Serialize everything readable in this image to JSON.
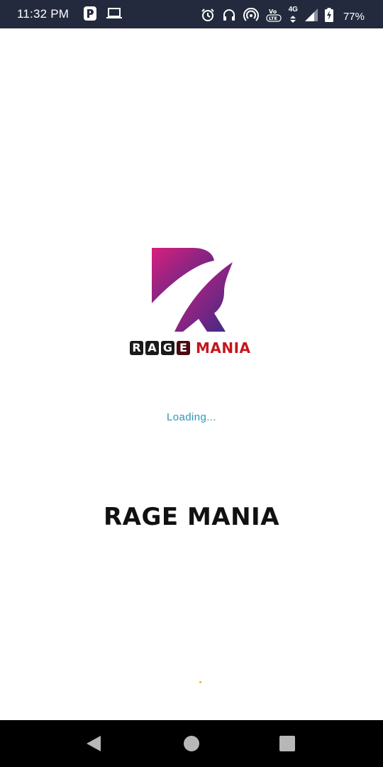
{
  "status_bar": {
    "time": "11:32 PM",
    "network_label": "4G",
    "volte_label": "Vo LTE",
    "battery_percent": "77%",
    "icons": [
      "p-app-icon",
      "laptop-icon",
      "alarm-icon",
      "headset-icon",
      "hotspot-icon",
      "volte-icon",
      "data-arrows-icon",
      "signal-icon",
      "battery-charging-icon"
    ]
  },
  "logo": {
    "letters": [
      "R",
      "A",
      "G",
      "E"
    ],
    "word": "MANIA",
    "colors": {
      "gradient_start": "#d81f7e",
      "gradient_end": "#3a2a86",
      "word": "#c4161c"
    }
  },
  "loading_text": "Loading...",
  "app_title": "RAGE MANIA",
  "navigation": {
    "icons": [
      "back-icon",
      "home-icon",
      "recents-icon"
    ]
  }
}
